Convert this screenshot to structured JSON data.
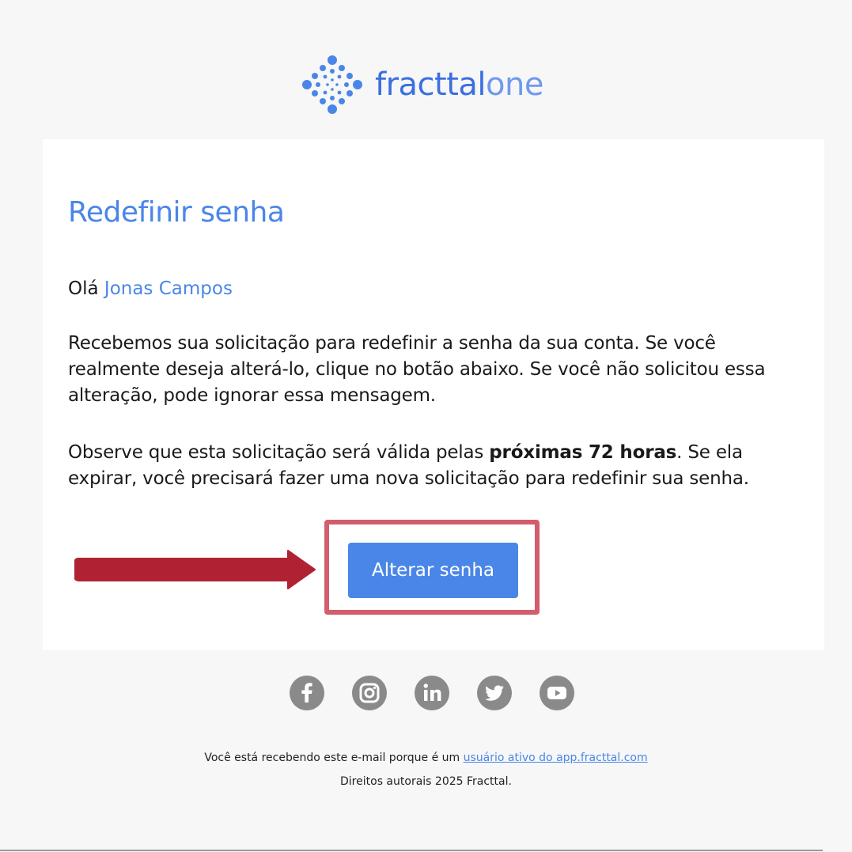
{
  "logo": {
    "name_part1": "fracttal",
    "name_part2": "one"
  },
  "email": {
    "title": "Redefinir senha",
    "greeting_prefix": "Olá",
    "user_name": "Jonas Campos",
    "paragraph1": "Recebemos sua solicitação para redefinir a senha da sua conta. Se você realmente deseja alterá-lo, clique no botão abaixo. Se você não solicitou essa alteração, pode ignorar essa mensagem.",
    "paragraph2_before": "Observe que esta solicitação será válida pelas",
    "paragraph2_bold": "próximas 72 horas",
    "paragraph2_after": ". Se ela expirar, você precisará fazer uma nova solicitação para redefinir sua senha.",
    "button_label": "Alterar senha"
  },
  "social": [
    {
      "icon": "facebook-icon"
    },
    {
      "icon": "instagram-icon"
    },
    {
      "icon": "linkedin-icon"
    },
    {
      "icon": "twitter-icon"
    },
    {
      "icon": "youtube-icon"
    }
  ],
  "footer": {
    "line1_text": "Você está recebendo este e-mail porque é um",
    "line1_link": "usuário ativo do app.fracttal.com",
    "line2": "Direitos autorais 2025 Fracttal."
  },
  "colors": {
    "brand_blue": "#4a86e8",
    "annotation_red": "#b02233",
    "highlight_border": "#d35c6d",
    "icon_gray": "#8a8a8a"
  }
}
